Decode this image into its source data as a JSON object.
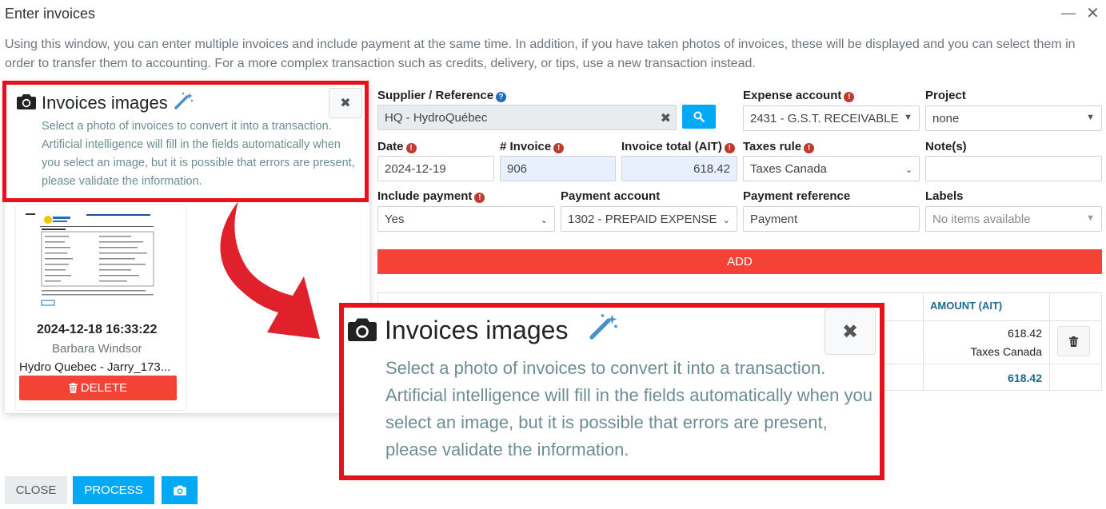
{
  "window": {
    "title": "Enter invoices",
    "minimize_icon": "minus-icon",
    "close_icon": "close-icon"
  },
  "intro": "Using this window, you can enter multiple invoices and include payment at the same time. In addition, if you have taken photos of invoices, these will be displayed and you can select them in order to transfer them to accounting. For a more complex transaction such as credits, delivery, or tips, use a new transaction instead.",
  "images_panel": {
    "title": "Invoices images",
    "description": "Select a photo of invoices to convert it into a transaction. Artificial intelligence will fill in the fields automatically when you select an image, but it is possible that errors are present, please validate the information.",
    "close_symbol": "✖",
    "image": {
      "datetime": "2024-12-18 16:33:22",
      "user": "Barbara Windsor",
      "filename": "Hydro Quebec - Jarry_173...",
      "delete_label": "DELETE"
    }
  },
  "form": {
    "supplier": {
      "label": "Supplier / Reference",
      "value": "HQ - HydroQuébec"
    },
    "expense_account": {
      "label": "Expense account",
      "value": "2431 - G.S.T. RECEIVABLE"
    },
    "project": {
      "label": "Project",
      "value": "none"
    },
    "date": {
      "label": "Date",
      "value": "2024-12-19"
    },
    "invoice_no": {
      "label": "# Invoice",
      "value": "906"
    },
    "invoice_total": {
      "label": "Invoice total (AIT)",
      "value": "618.42"
    },
    "taxes_rule": {
      "label": "Taxes rule",
      "value": "Taxes Canada"
    },
    "notes": {
      "label": "Note(s)",
      "value": ""
    },
    "include_payment": {
      "label": "Include payment",
      "value": "Yes"
    },
    "payment_account": {
      "label": "Payment account",
      "value": "1302 - PREPAID EXPENSE"
    },
    "payment_reference": {
      "label": "Payment reference",
      "value": "Payment"
    },
    "labels": {
      "label": "Labels",
      "placeholder": "No items available"
    },
    "add_label": "ADD"
  },
  "table": {
    "headers": {
      "amount": "AMOUNT (AIT)"
    },
    "row": {
      "amount": "618.42",
      "tax": "Taxes Canada"
    },
    "total": "618.42"
  },
  "footer": {
    "close_label": "CLOSE",
    "process_label": "PROCESS"
  },
  "colors": {
    "accent_blue": "#03a9f4",
    "danger_red": "#f44336",
    "callout_red": "#e8101b",
    "arrow_red": "#e0212b"
  }
}
